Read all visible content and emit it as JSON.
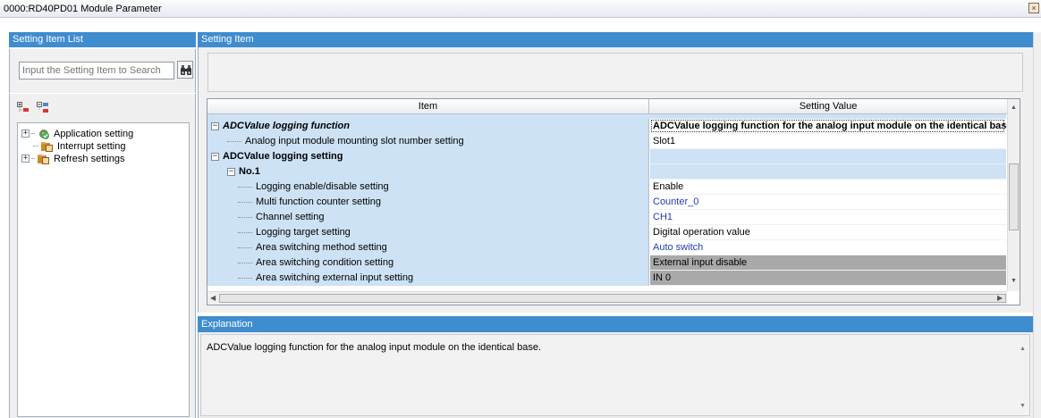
{
  "window": {
    "title": "0000:RD40PD01 Module Parameter",
    "close_glyph": "×"
  },
  "left_pane": {
    "header": "Setting Item List",
    "search_placeholder": "Input the Setting Item to Search",
    "tree": [
      {
        "label": "Application setting",
        "icon": "gear-check-icon",
        "expander": "+"
      },
      {
        "label": "Interrupt setting",
        "icon": "settings-folder-icon",
        "expander": ""
      },
      {
        "label": "Refresh settings",
        "icon": "settings-folder-icon",
        "expander": "+"
      }
    ]
  },
  "right_pane": {
    "header": "Setting Item",
    "grid": {
      "col_item": "Item",
      "col_value": "Setting Value",
      "rows": [
        {
          "item": "ADCValue logging function",
          "value": "ADCValue logging function for the analog input module on the identical base.",
          "level": 0,
          "expander": "−",
          "style": "bold-italic",
          "value_style": "selected"
        },
        {
          "item": "Analog input module mounting slot number setting",
          "value": "Slot1",
          "level": 1,
          "expander": "",
          "style": "normal",
          "value_style": "normal"
        },
        {
          "item": "ADCValue logging setting",
          "value": "",
          "level": 0,
          "expander": "−",
          "style": "bold",
          "value_style": "blue"
        },
        {
          "item": "No.1",
          "value": "",
          "level": 1,
          "expander": "−",
          "style": "bold",
          "value_style": "blue"
        },
        {
          "item": "Logging enable/disable setting",
          "value": "Enable",
          "level": 2,
          "expander": "",
          "style": "normal",
          "value_style": "normal"
        },
        {
          "item": "Multi function counter setting",
          "value": "Counter_0",
          "level": 2,
          "expander": "",
          "style": "normal",
          "value_style": "link"
        },
        {
          "item": "Channel setting",
          "value": "CH1",
          "level": 2,
          "expander": "",
          "style": "normal",
          "value_style": "link"
        },
        {
          "item": "Logging target setting",
          "value": "Digital operation value",
          "level": 2,
          "expander": "",
          "style": "normal",
          "value_style": "normal"
        },
        {
          "item": "Area switching method setting",
          "value": "Auto switch",
          "level": 2,
          "expander": "",
          "style": "normal",
          "value_style": "link"
        },
        {
          "item": "Area switching condition setting",
          "value": "External input disable",
          "level": 2,
          "expander": "",
          "style": "normal",
          "value_style": "grey"
        },
        {
          "item": "Area switching external input setting",
          "value": "IN 0",
          "level": 2,
          "expander": "",
          "style": "normal",
          "value_style": "grey"
        }
      ]
    }
  },
  "explanation": {
    "header": "Explanation",
    "text": "ADCValue logging function for the analog input module on the identical base."
  },
  "colors": {
    "header_blue": "#3f8ccf",
    "item_cell_blue": "#cde2f5",
    "link_blue": "#1f3fb0",
    "disabled_grey": "#a9a9a9"
  }
}
